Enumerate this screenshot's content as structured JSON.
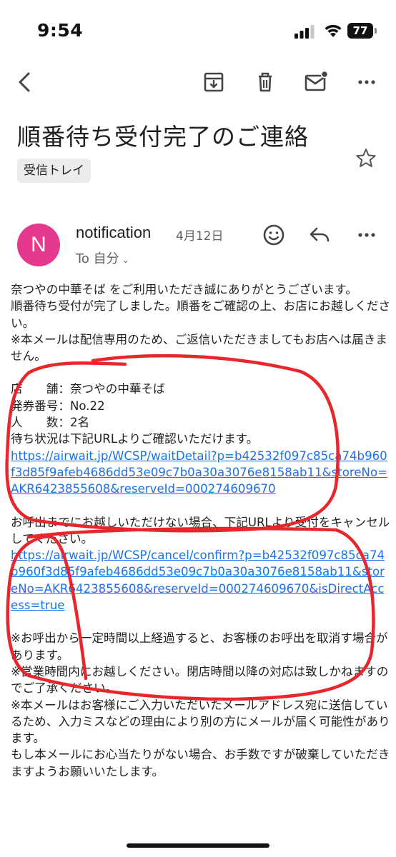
{
  "status_bar": {
    "time": "9:54",
    "battery_level": "77"
  },
  "toolbar": {
    "icons": [
      "back-icon",
      "archive-icon",
      "trash-icon",
      "mark-unread-icon",
      "more-icon"
    ]
  },
  "email": {
    "subject": "順番待ち受付完了のご連絡",
    "label": "受信トレイ",
    "sender": {
      "avatar_letter": "N",
      "avatar_color": "#e4398c",
      "name": "notification",
      "date": "4月12日",
      "recipient": "To 自分"
    },
    "body": {
      "intro": [
        "奈つやの中華そば をご利用いただき誠にありがとうございます。",
        "順番待ち受付が完了しました。順番をご確認の上、お店にお越しください。",
        "※本メールは配信専用のため、ご返信いただきましてもお店へは届きません。"
      ],
      "details": [
        "店　　舗：奈つやの中華そば",
        "発券番号：No.22",
        "人　　数：2名"
      ],
      "status_note": "待ち状況は下記URLよりご確認いただけます。",
      "status_link": "https://airwait.jp/WCSP/waitDetail?p=b42532f097c85ca74b960f3d85f9afeb4686dd53e09c7b0a30a3076e8158ab11&storeNo=AKR6423855608&reserveId=000274609670",
      "cancel_note": "お呼出までにお越しいただけない場合、下記URLより受付をキャンセルしてください。",
      "cancel_link": "https://airwait.jp/WCSP/cancel/confirm?p=b42532f097c85ca74b960f3d85f9afeb4686dd53e09c7b0a30a3076e8158ab11&storeNo=AKR6423855608&reserveId=000274609670&isDirectAccess=true",
      "notes": [
        "※お呼出から一定時間以上経過すると、お客様のお呼出を取消す場合があります。",
        "※営業時間内にお越しください。閉店時間以降の対応は致しかねますのでご了承ください。",
        "※本メールはお客様にご入力いただいたメールアドレス宛に送信しているため、入力ミスなどの理由により別の方にメールが届く可能性があります。",
        "もし本メールにお心当たりがない場合、お手数ですが破棄していただきますようお願いいたします。"
      ]
    }
  },
  "annotation_color": "#e8262b"
}
